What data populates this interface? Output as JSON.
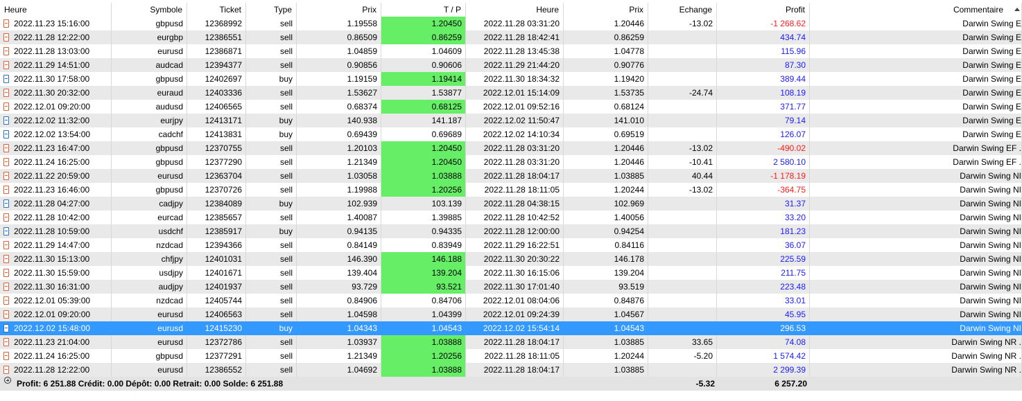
{
  "columns": [
    "Heure",
    "Symbole",
    "Ticket",
    "Type",
    "Prix",
    "T / P",
    "Heure",
    "Prix",
    "Echange",
    "Profit",
    "Commentaire"
  ],
  "rows": [
    {
      "open_time": "2022.11.23 15:16:00",
      "symbol": "gbpusd",
      "ticket": "12368992",
      "type": "sell",
      "price": "1.19558",
      "tp": "1.20450",
      "tp_hit": true,
      "close_time": "2022.11.28 03:31:20",
      "close_price": "1.20446",
      "swap": "-13.02",
      "profit": "-1 268.62",
      "profit_sign": "neg",
      "comment": "Darwin Swing E"
    },
    {
      "open_time": "2022.11.28 12:22:00",
      "symbol": "eurgbp",
      "ticket": "12386551",
      "type": "sell",
      "price": "0.86509",
      "tp": "0.86259",
      "tp_hit": true,
      "close_time": "2022.11.28 18:42:41",
      "close_price": "0.86259",
      "swap": "",
      "profit": "434.74",
      "profit_sign": "pos",
      "comment": "Darwin Swing E"
    },
    {
      "open_time": "2022.11.28 13:03:00",
      "symbol": "eurusd",
      "ticket": "12386871",
      "type": "sell",
      "price": "1.04859",
      "tp": "1.04609",
      "tp_hit": false,
      "close_time": "2022.11.28 13:45:38",
      "close_price": "1.04778",
      "swap": "",
      "profit": "115.96",
      "profit_sign": "pos",
      "comment": "Darwin Swing E"
    },
    {
      "open_time": "2022.11.29 14:51:00",
      "symbol": "audcad",
      "ticket": "12394377",
      "type": "sell",
      "price": "0.90856",
      "tp": "0.90606",
      "tp_hit": false,
      "close_time": "2022.11.29 21:44:20",
      "close_price": "0.90776",
      "swap": "",
      "profit": "87.30",
      "profit_sign": "pos",
      "comment": "Darwin Swing E"
    },
    {
      "open_time": "2022.11.30 17:58:00",
      "symbol": "gbpusd",
      "ticket": "12402697",
      "type": "buy",
      "price": "1.19159",
      "tp": "1.19414",
      "tp_hit": true,
      "close_time": "2022.11.30 18:34:32",
      "close_price": "1.19420",
      "swap": "",
      "profit": "389.44",
      "profit_sign": "pos",
      "comment": "Darwin Swing E"
    },
    {
      "open_time": "2022.11.30 20:32:00",
      "symbol": "euraud",
      "ticket": "12403336",
      "type": "sell",
      "price": "1.53627",
      "tp": "1.53877",
      "tp_hit": false,
      "close_time": "2022.12.01 15:14:09",
      "close_price": "1.53735",
      "swap": "-24.74",
      "profit": "108.19",
      "profit_sign": "pos",
      "comment": "Darwin Swing E"
    },
    {
      "open_time": "2022.12.01 09:20:00",
      "symbol": "audusd",
      "ticket": "12406565",
      "type": "sell",
      "price": "0.68374",
      "tp": "0.68125",
      "tp_hit": true,
      "close_time": "2022.12.01 09:52:16",
      "close_price": "0.68124",
      "swap": "",
      "profit": "371.77",
      "profit_sign": "pos",
      "comment": "Darwin Swing E"
    },
    {
      "open_time": "2022.12.02 11:32:00",
      "symbol": "eurjpy",
      "ticket": "12413171",
      "type": "buy",
      "price": "140.938",
      "tp": "141.187",
      "tp_hit": false,
      "close_time": "2022.12.02 11:50:47",
      "close_price": "141.010",
      "swap": "",
      "profit": "79.14",
      "profit_sign": "pos",
      "comment": "Darwin Swing E"
    },
    {
      "open_time": "2022.12.02 13:54:00",
      "symbol": "cadchf",
      "ticket": "12413831",
      "type": "buy",
      "price": "0.69439",
      "tp": "0.69689",
      "tp_hit": false,
      "close_time": "2022.12.02 14:10:34",
      "close_price": "0.69519",
      "swap": "",
      "profit": "126.07",
      "profit_sign": "pos",
      "comment": "Darwin Swing E"
    },
    {
      "open_time": "2022.11.23 16:47:00",
      "symbol": "gbpusd",
      "ticket": "12370755",
      "type": "sell",
      "price": "1.20103",
      "tp": "1.20450",
      "tp_hit": true,
      "close_time": "2022.11.28 03:31:20",
      "close_price": "1.20446",
      "swap": "-13.02",
      "profit": "-490.02",
      "profit_sign": "neg",
      "comment": "Darwin Swing EF ."
    },
    {
      "open_time": "2022.11.24 16:25:00",
      "symbol": "gbpusd",
      "ticket": "12377290",
      "type": "sell",
      "price": "1.21349",
      "tp": "1.20450",
      "tp_hit": true,
      "close_time": "2022.11.28 03:31:20",
      "close_price": "1.20446",
      "swap": "-10.41",
      "profit": "2 580.10",
      "profit_sign": "pos",
      "comment": "Darwin Swing EF ."
    },
    {
      "open_time": "2022.11.22 20:59:00",
      "symbol": "eurusd",
      "ticket": "12363704",
      "type": "sell",
      "price": "1.03058",
      "tp": "1.03888",
      "tp_hit": true,
      "close_time": "2022.11.28 18:04:17",
      "close_price": "1.03885",
      "swap": "40.44",
      "profit": "-1 178.19",
      "profit_sign": "neg",
      "comment": "Darwin Swing NI"
    },
    {
      "open_time": "2022.11.23 16:46:00",
      "symbol": "gbpusd",
      "ticket": "12370726",
      "type": "sell",
      "price": "1.19988",
      "tp": "1.20256",
      "tp_hit": true,
      "close_time": "2022.11.28 18:11:05",
      "close_price": "1.20244",
      "swap": "-13.02",
      "profit": "-364.75",
      "profit_sign": "neg",
      "comment": "Darwin Swing NI"
    },
    {
      "open_time": "2022.11.28 04:27:00",
      "symbol": "cadjpy",
      "ticket": "12384089",
      "type": "buy",
      "price": "102.939",
      "tp": "103.139",
      "tp_hit": false,
      "close_time": "2022.11.28 04:38:15",
      "close_price": "102.969",
      "swap": "",
      "profit": "31.37",
      "profit_sign": "pos",
      "comment": "Darwin Swing NI"
    },
    {
      "open_time": "2022.11.28 10:42:00",
      "symbol": "eurcad",
      "ticket": "12385657",
      "type": "sell",
      "price": "1.40087",
      "tp": "1.39885",
      "tp_hit": false,
      "close_time": "2022.11.28 10:42:52",
      "close_price": "1.40056",
      "swap": "",
      "profit": "33.20",
      "profit_sign": "pos",
      "comment": "Darwin Swing NI"
    },
    {
      "open_time": "2022.11.28 10:59:00",
      "symbol": "usdchf",
      "ticket": "12385917",
      "type": "buy",
      "price": "0.94135",
      "tp": "0.94335",
      "tp_hit": false,
      "close_time": "2022.11.28 12:00:00",
      "close_price": "0.94254",
      "swap": "",
      "profit": "181.23",
      "profit_sign": "pos",
      "comment": "Darwin Swing NI"
    },
    {
      "open_time": "2022.11.29 14:47:00",
      "symbol": "nzdcad",
      "ticket": "12394366",
      "type": "sell",
      "price": "0.84149",
      "tp": "0.83949",
      "tp_hit": false,
      "close_time": "2022.11.29 16:22:51",
      "close_price": "0.84116",
      "swap": "",
      "profit": "36.07",
      "profit_sign": "pos",
      "comment": "Darwin Swing NI"
    },
    {
      "open_time": "2022.11.30 15:13:00",
      "symbol": "chfjpy",
      "ticket": "12401031",
      "type": "sell",
      "price": "146.390",
      "tp": "146.188",
      "tp_hit": true,
      "close_time": "2022.11.30 20:30:22",
      "close_price": "146.178",
      "swap": "",
      "profit": "225.59",
      "profit_sign": "pos",
      "comment": "Darwin Swing NI"
    },
    {
      "open_time": "2022.11.30 15:59:00",
      "symbol": "usdjpy",
      "ticket": "12401671",
      "type": "sell",
      "price": "139.404",
      "tp": "139.204",
      "tp_hit": true,
      "close_time": "2022.11.30 16:15:06",
      "close_price": "139.204",
      "swap": "",
      "profit": "211.75",
      "profit_sign": "pos",
      "comment": "Darwin Swing NI"
    },
    {
      "open_time": "2022.11.30 16:31:00",
      "symbol": "audjpy",
      "ticket": "12401937",
      "type": "sell",
      "price": "93.729",
      "tp": "93.521",
      "tp_hit": true,
      "close_time": "2022.11.30 17:01:40",
      "close_price": "93.519",
      "swap": "",
      "profit": "223.48",
      "profit_sign": "pos",
      "comment": "Darwin Swing NI"
    },
    {
      "open_time": "2022.12.01 05:39:00",
      "symbol": "nzdcad",
      "ticket": "12405744",
      "type": "sell",
      "price": "0.84906",
      "tp": "0.84706",
      "tp_hit": false,
      "close_time": "2022.12.01 08:04:06",
      "close_price": "0.84876",
      "swap": "",
      "profit": "33.01",
      "profit_sign": "pos",
      "comment": "Darwin Swing NI"
    },
    {
      "open_time": "2022.12.01 09:20:00",
      "symbol": "eurusd",
      "ticket": "12406563",
      "type": "sell",
      "price": "1.04598",
      "tp": "1.04399",
      "tp_hit": false,
      "close_time": "2022.12.01 09:24:39",
      "close_price": "1.04567",
      "swap": "",
      "profit": "45.95",
      "profit_sign": "pos",
      "comment": "Darwin Swing NI"
    },
    {
      "open_time": "2022.12.02 15:48:00",
      "symbol": "eurusd",
      "ticket": "12415230",
      "type": "buy",
      "price": "1.04343",
      "tp": "1.04543",
      "tp_hit": true,
      "close_time": "2022.12.02 15:54:14",
      "close_price": "1.04543",
      "swap": "",
      "profit": "296.53",
      "profit_sign": "pos",
      "comment": "Darwin Swing NI",
      "selected": true
    },
    {
      "open_time": "2022.11.23 21:04:00",
      "symbol": "eurusd",
      "ticket": "12372786",
      "type": "sell",
      "price": "1.03937",
      "tp": "1.03888",
      "tp_hit": true,
      "close_time": "2022.11.28 18:04:17",
      "close_price": "1.03885",
      "swap": "33.65",
      "profit": "74.08",
      "profit_sign": "pos",
      "comment": "Darwin Swing NR ."
    },
    {
      "open_time": "2022.11.24 16:25:00",
      "symbol": "gbpusd",
      "ticket": "12377291",
      "type": "sell",
      "price": "1.21349",
      "tp": "1.20256",
      "tp_hit": true,
      "close_time": "2022.11.28 18:11:05",
      "close_price": "1.20244",
      "swap": "-5.20",
      "profit": "1 574.42",
      "profit_sign": "pos",
      "comment": "Darwin Swing NR ."
    },
    {
      "open_time": "2022.11.28 12:22:00",
      "symbol": "eurusd",
      "ticket": "12386552",
      "type": "sell",
      "price": "1.04692",
      "tp": "1.03888",
      "tp_hit": true,
      "close_time": "2022.11.28 18:04:17",
      "close_price": "1.03885",
      "swap": "",
      "profit": "2 299.39",
      "profit_sign": "pos",
      "comment": "Darwin Swing NR ."
    }
  ],
  "footer": {
    "summary": "Profit: 6 251.88  Crédit: 0.00  Dépôt: 0.00  Retrait: 0.00  Solde: 6 251.88",
    "swap_total": "-5.32",
    "profit_total": "6 257.20"
  },
  "colors": {
    "tp_hit": "#66ee66",
    "selected": "#3399ff",
    "profit_pos": "#1a1aff",
    "profit_neg": "#ff1a1a",
    "row_alt": "#e9e9e9"
  }
}
